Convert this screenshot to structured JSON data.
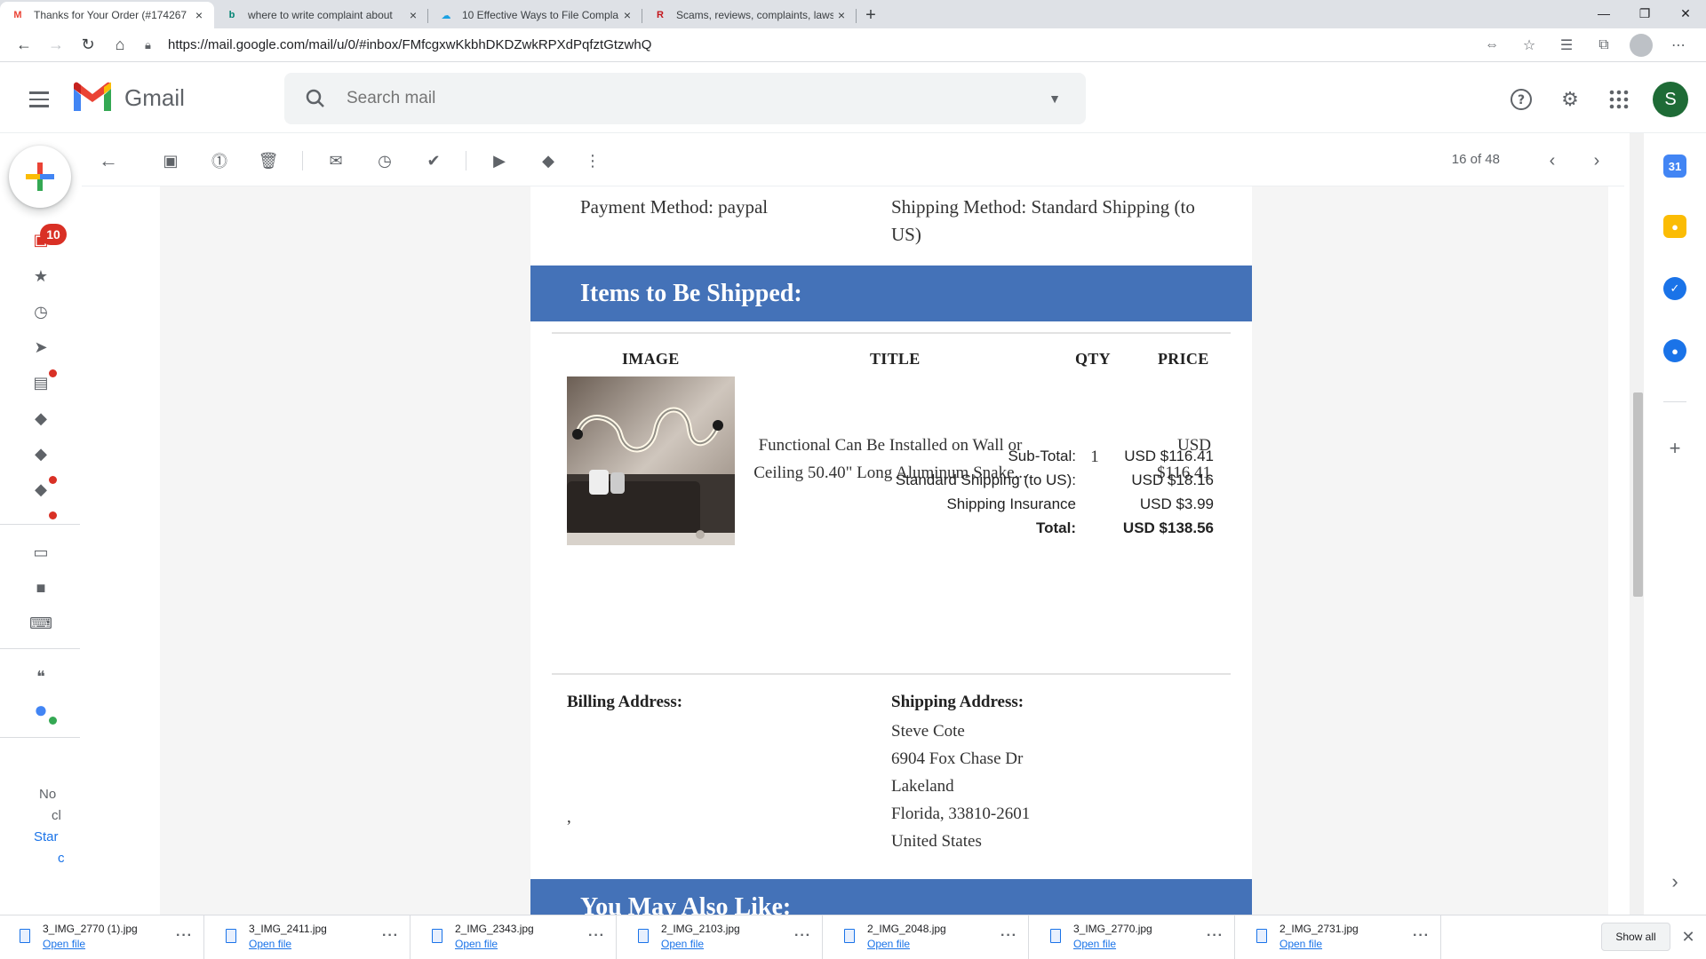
{
  "browser": {
    "tabs": [
      {
        "title": "Thanks for Your Order (#174267",
        "favicon": "gmail-icon",
        "favicon_glyph": "M",
        "favicon_color": "#ea4335",
        "active": true
      },
      {
        "title": "where to write complaint about",
        "favicon": "bing-icon",
        "favicon_glyph": "b",
        "favicon_color": "#008373",
        "active": false
      },
      {
        "title": "10 Effective Ways to File Compla",
        "favicon": "cloud-icon",
        "favicon_glyph": "☁",
        "favicon_color": "#1ba1e2",
        "active": false
      },
      {
        "title": "Scams, reviews, complaints, laws",
        "favicon": "ripoff-icon",
        "favicon_glyph": "R",
        "favicon_color": "#c4161c",
        "active": false
      }
    ],
    "close_glyph": "×",
    "newtab_glyph": "+",
    "url": "https://mail.google.com/mail/u/0/#inbox/FMfcgxwKkbhDKDZwkRPXdPqfztGtzwhQ"
  },
  "gmail": {
    "app_name": "Gmail",
    "search_placeholder": "Search mail",
    "avatar_letter": "S",
    "avatar_color": "#1e6b36",
    "inbox_badge": "10",
    "pager": "16 of 48",
    "rail_text": [
      "No",
      "cl",
      "Star",
      "c"
    ]
  },
  "email": {
    "payment_method": "Payment Method: paypal",
    "shipping_method": "Shipping Method: Standard Shipping (to US)",
    "items_banner": "Items to Be Shipped:",
    "headers": {
      "image": "IMAGE",
      "title": "TITLE",
      "qty": "QTY",
      "price": "PRICE"
    },
    "item": {
      "title": "Functional Can Be Installed on Wall or Ceiling 50.40\" Long Aluminum Snake...",
      "qty": "1",
      "price": "USD $116.41"
    },
    "totals": [
      {
        "label": "Sub-Total:",
        "value": "USD $116.41",
        "bold": false
      },
      {
        "label": "Standard Shipping (to US):",
        "value": "USD $18.16",
        "bold": false
      },
      {
        "label": "Shipping Insurance",
        "value": "USD $3.99",
        "bold": false
      },
      {
        "label": "Total:",
        "value": "USD $138.56",
        "bold": true
      }
    ],
    "billing_label": "Billing Address:",
    "billing_comma": ",",
    "shipping_label": "Shipping Address:",
    "shipping_lines": [
      "Steve Cote",
      "6904 Fox Chase Dr",
      "Lakeland",
      "Florida, 33810-2601",
      "United States"
    ],
    "also_like_banner": "You May Also Like:",
    "banner_color": "#4472b8"
  },
  "downloads": {
    "items": [
      {
        "name": "3_IMG_2770 (1).jpg",
        "action": "Open file"
      },
      {
        "name": "3_IMG_2411.jpg",
        "action": "Open file"
      },
      {
        "name": "2_IMG_2343.jpg",
        "action": "Open file"
      },
      {
        "name": "2_IMG_2103.jpg",
        "action": "Open file"
      },
      {
        "name": "2_IMG_2048.jpg",
        "action": "Open file"
      },
      {
        "name": "3_IMG_2770.jpg",
        "action": "Open file"
      },
      {
        "name": "2_IMG_2731.jpg",
        "action": "Open file"
      }
    ],
    "show_all": "Show all"
  }
}
